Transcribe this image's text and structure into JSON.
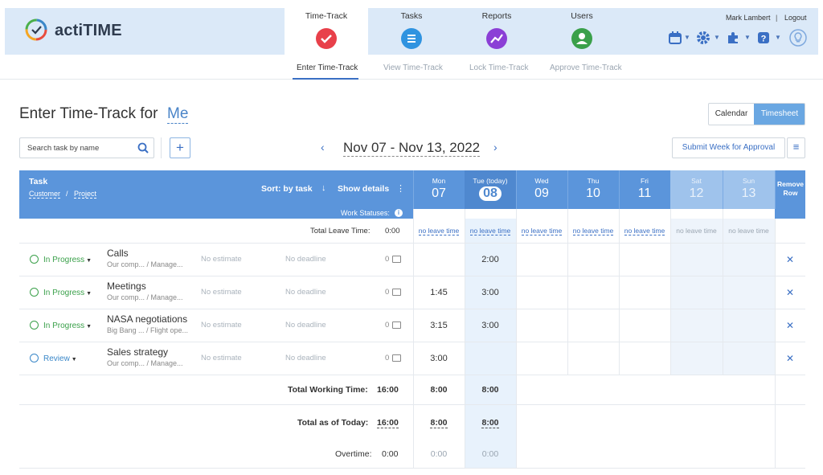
{
  "app": {
    "brand": "actiTIME"
  },
  "nav": {
    "tabs": [
      {
        "label": "Time-Track"
      },
      {
        "label": "Tasks"
      },
      {
        "label": "Reports"
      },
      {
        "label": "Users"
      }
    ]
  },
  "user": {
    "name": "Mark Lambert",
    "separator": "|",
    "logout": "Logout"
  },
  "subnav": [
    "Enter Time-Track",
    "View Time-Track",
    "Lock Time-Track",
    "Approve Time-Track"
  ],
  "page": {
    "title": "Enter Time-Track for",
    "who": "Me"
  },
  "view_toggle": {
    "calendar": "Calendar",
    "timesheet": "Timesheet"
  },
  "search": {
    "placeholder": "Search task by name"
  },
  "add_button": "+",
  "week": {
    "prev": "‹",
    "range": "Nov 07 - Nov 13, 2022",
    "next": "›"
  },
  "submit_button": "Submit Week for Approval",
  "table": {
    "task_header": "Task",
    "customer": "Customer",
    "slash": "/",
    "project": "Project",
    "sort": "Sort: by task",
    "sort_arrow": "↓",
    "details": "Show details",
    "details_menu": "⋮",
    "work_statuses": "Work Statuses:",
    "info": "i",
    "remove_header": "Remove Row",
    "days": [
      {
        "name": "Mon",
        "date": "07"
      },
      {
        "name": "Tue (today)",
        "date": "08"
      },
      {
        "name": "Wed",
        "date": "09"
      },
      {
        "name": "Thu",
        "date": "10"
      },
      {
        "name": "Fri",
        "date": "11"
      },
      {
        "name": "Sat",
        "date": "12"
      },
      {
        "name": "Sun",
        "date": "13"
      }
    ],
    "leave_label": "Total Leave Time:",
    "leave_total": "0:00",
    "leave_cells": [
      "no leave time",
      "no leave time",
      "no leave time",
      "no leave time",
      "no leave time",
      "no leave time",
      "no leave time"
    ],
    "rows": [
      {
        "status": "In Progress",
        "name": "Calls",
        "path": "Our comp... / Manage...",
        "estimate": "No estimate",
        "deadline": "No deadline",
        "comments": "0",
        "times": [
          "",
          "2:00",
          "",
          "",
          "",
          "",
          ""
        ]
      },
      {
        "status": "In Progress",
        "name": "Meetings",
        "path": "Our comp... / Manage...",
        "estimate": "No estimate",
        "deadline": "No deadline",
        "comments": "0",
        "times": [
          "1:45",
          "3:00",
          "",
          "",
          "",
          "",
          ""
        ]
      },
      {
        "status": "In Progress",
        "name": "NASA negotiations",
        "path": "Big Bang ... / Flight ope...",
        "estimate": "No estimate",
        "deadline": "No deadline",
        "comments": "0",
        "times": [
          "3:15",
          "3:00",
          "",
          "",
          "",
          "",
          ""
        ]
      },
      {
        "status": "Review",
        "name": "Sales strategy",
        "path": "Our comp... / Manage...",
        "estimate": "No estimate",
        "deadline": "No deadline",
        "comments": "0",
        "times": [
          "3:00",
          "",
          "",
          "",
          "",
          "",
          ""
        ]
      }
    ],
    "remove_icon": "✕",
    "total_working_label": "Total Working Time:",
    "total_working": "16:00",
    "total_working_days": [
      "8:00",
      "8:00"
    ],
    "total_today_label": "Total as of Today:",
    "total_today": "16:00",
    "total_today_days": [
      "8:00",
      "8:00"
    ],
    "overtime_label": "Overtime:",
    "overtime": "0:00",
    "overtime_days": [
      "0:00",
      "0:00"
    ]
  },
  "colors": {
    "accent": "#5b95db",
    "today": "#4f88cf",
    "in_progress": "#3aa04a",
    "review": "#3a87c8"
  }
}
